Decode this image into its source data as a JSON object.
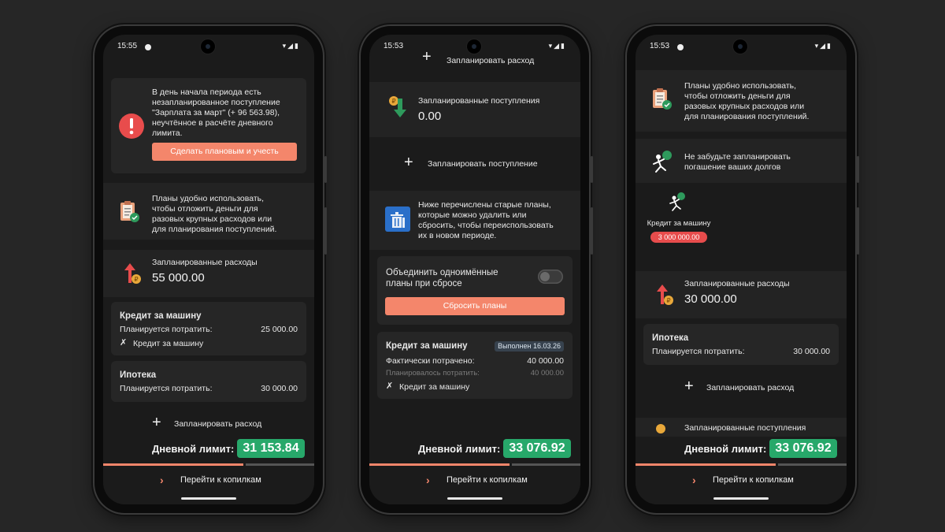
{
  "phone1": {
    "status_time": "15:55",
    "warning": {
      "text_lines": [
        "В день начала периода есть",
        "незапланированное поступление",
        "\"Зарплата за март\" (+ 96 563.98),",
        "неучтённое в расчёте дневного",
        "лимита."
      ],
      "button": "Сделать плановым и учесть"
    },
    "hint_lines": [
      "Планы удобно использовать,",
      "чтобы отложить деньги для",
      "разовых крупных расходов или",
      "для планирования поступлений."
    ],
    "planned_expenses": {
      "label": "Запланированные расходы",
      "value": "55 000.00"
    },
    "plans": [
      {
        "title": "Кредит за машину",
        "sub_label": "Планируется потратить:",
        "amount": "25 000.00",
        "linked": "Кредит за машину"
      },
      {
        "title": "Ипотека",
        "sub_label": "Планируется потратить:",
        "amount": "30 000.00"
      }
    ],
    "add_expense": "Запланировать расход",
    "daily_limit_label": "Дневной лимит:",
    "daily_limit_value": "31 153.84",
    "nav_label": "Перейти к копилкам"
  },
  "phone2": {
    "status_time": "15:53",
    "add_expense_top": "Запланировать расход",
    "planned_income": {
      "label": "Запланированные поступления",
      "value": "0.00"
    },
    "add_income": "Запланировать поступление",
    "old_plans_lines": [
      "Ниже перечислены старые планы,",
      "которые можно удалить или",
      "сбросить, чтобы переиспользовать",
      "их в новом периоде."
    ],
    "merge_lines": [
      "Объединить одноимённые",
      "планы при сбросе"
    ],
    "reset_button": "Сбросить планы",
    "plan": {
      "title": "Кредит за машину",
      "badge": "Выполнен 16.03.26",
      "spent_label": "Фактически потрачено:",
      "spent_value": "40 000.00",
      "planned_label": "Планировалось потратить:",
      "planned_value": "40 000.00",
      "linked": "Кредит за машину"
    },
    "daily_limit_label": "Дневной лимит:",
    "daily_limit_value": "33 076.92",
    "nav_label": "Перейти к копилкам"
  },
  "phone3": {
    "status_time": "15:53",
    "hint_lines": [
      "Планы удобно использовать,",
      "чтобы отложить деньги для",
      "разовых крупных расходов или",
      "для планирования поступлений."
    ],
    "debt_hint_lines": [
      "Не забудьте запланировать",
      "погашение ваших долгов"
    ],
    "debt": {
      "name": "Кредит за машину",
      "amount": "3 000 000.00"
    },
    "planned_expenses": {
      "label": "Запланированные расходы",
      "value": "30 000.00"
    },
    "plan": {
      "title": "Ипотека",
      "sub_label": "Планируется потратить:",
      "amount": "30 000.00"
    },
    "add_expense": "Запланировать расход",
    "planned_income_partial": "Запланированные поступления",
    "daily_limit_label": "Дневной лимит:",
    "daily_limit_value": "33 076.92",
    "nav_label": "Перейти к копилкам"
  },
  "colors": {
    "accent": "#f4866b",
    "limit": "#27a86a",
    "danger": "#e74c4c",
    "background": "#262626"
  }
}
